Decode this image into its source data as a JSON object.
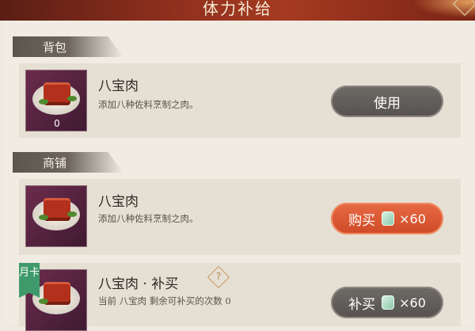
{
  "header": {
    "title": "体力补给"
  },
  "backpack": {
    "section_label": "背包",
    "item": {
      "name": "八宝肉",
      "desc": "添加八种佐料烹制之肉。",
      "count": "0",
      "button": "使用"
    }
  },
  "shop": {
    "section_label": "商铺",
    "item": {
      "name": "八宝肉",
      "desc": "添加八种佐料烹制之肉。",
      "button": "购买",
      "price": "×60"
    },
    "refill": {
      "badge": "月卡",
      "name": "八宝肉 · 补买",
      "help": "?",
      "desc": "当前 八宝肉 剩余可补买的次数 0",
      "button": "补买",
      "price": "×60"
    }
  },
  "colors": {
    "title_bar": "#8e2f1d",
    "buy_button": "#e05a36",
    "gray_button": "#605c58",
    "badge": "#3f9a6b"
  },
  "icons": {
    "currency": "jade-icon",
    "help": "question-diamond-icon"
  }
}
